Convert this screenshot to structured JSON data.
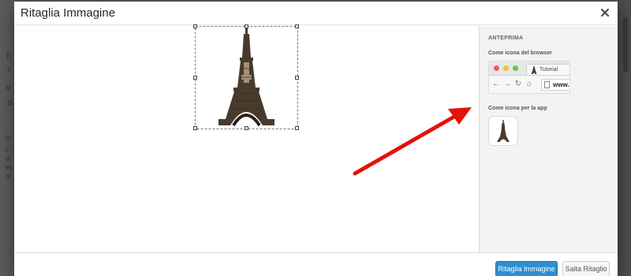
{
  "modal": {
    "title": "Ritaglia Immagine",
    "close_icon": "close-icon"
  },
  "background": {
    "fragments": [
      "Ti",
      "T",
      "M",
      "Si",
      "Ic",
      "L'",
      "sl",
      "es",
      "ol"
    ]
  },
  "preview": {
    "heading": "Anteprima",
    "browser_label": "Come icona del browser",
    "tab_title": "Tutorial",
    "url_text": "www.",
    "app_label": "Come icona per la app"
  },
  "footer": {
    "crop_button": "Ritaglia Immagine",
    "skip_button": "Salta Ritaglio"
  },
  "colors": {
    "primary": "#2e8ecf",
    "arrow": "#e3120b",
    "sidebar_bg": "#f3f3f3"
  },
  "image": {
    "subject": "eiffel-tower"
  }
}
